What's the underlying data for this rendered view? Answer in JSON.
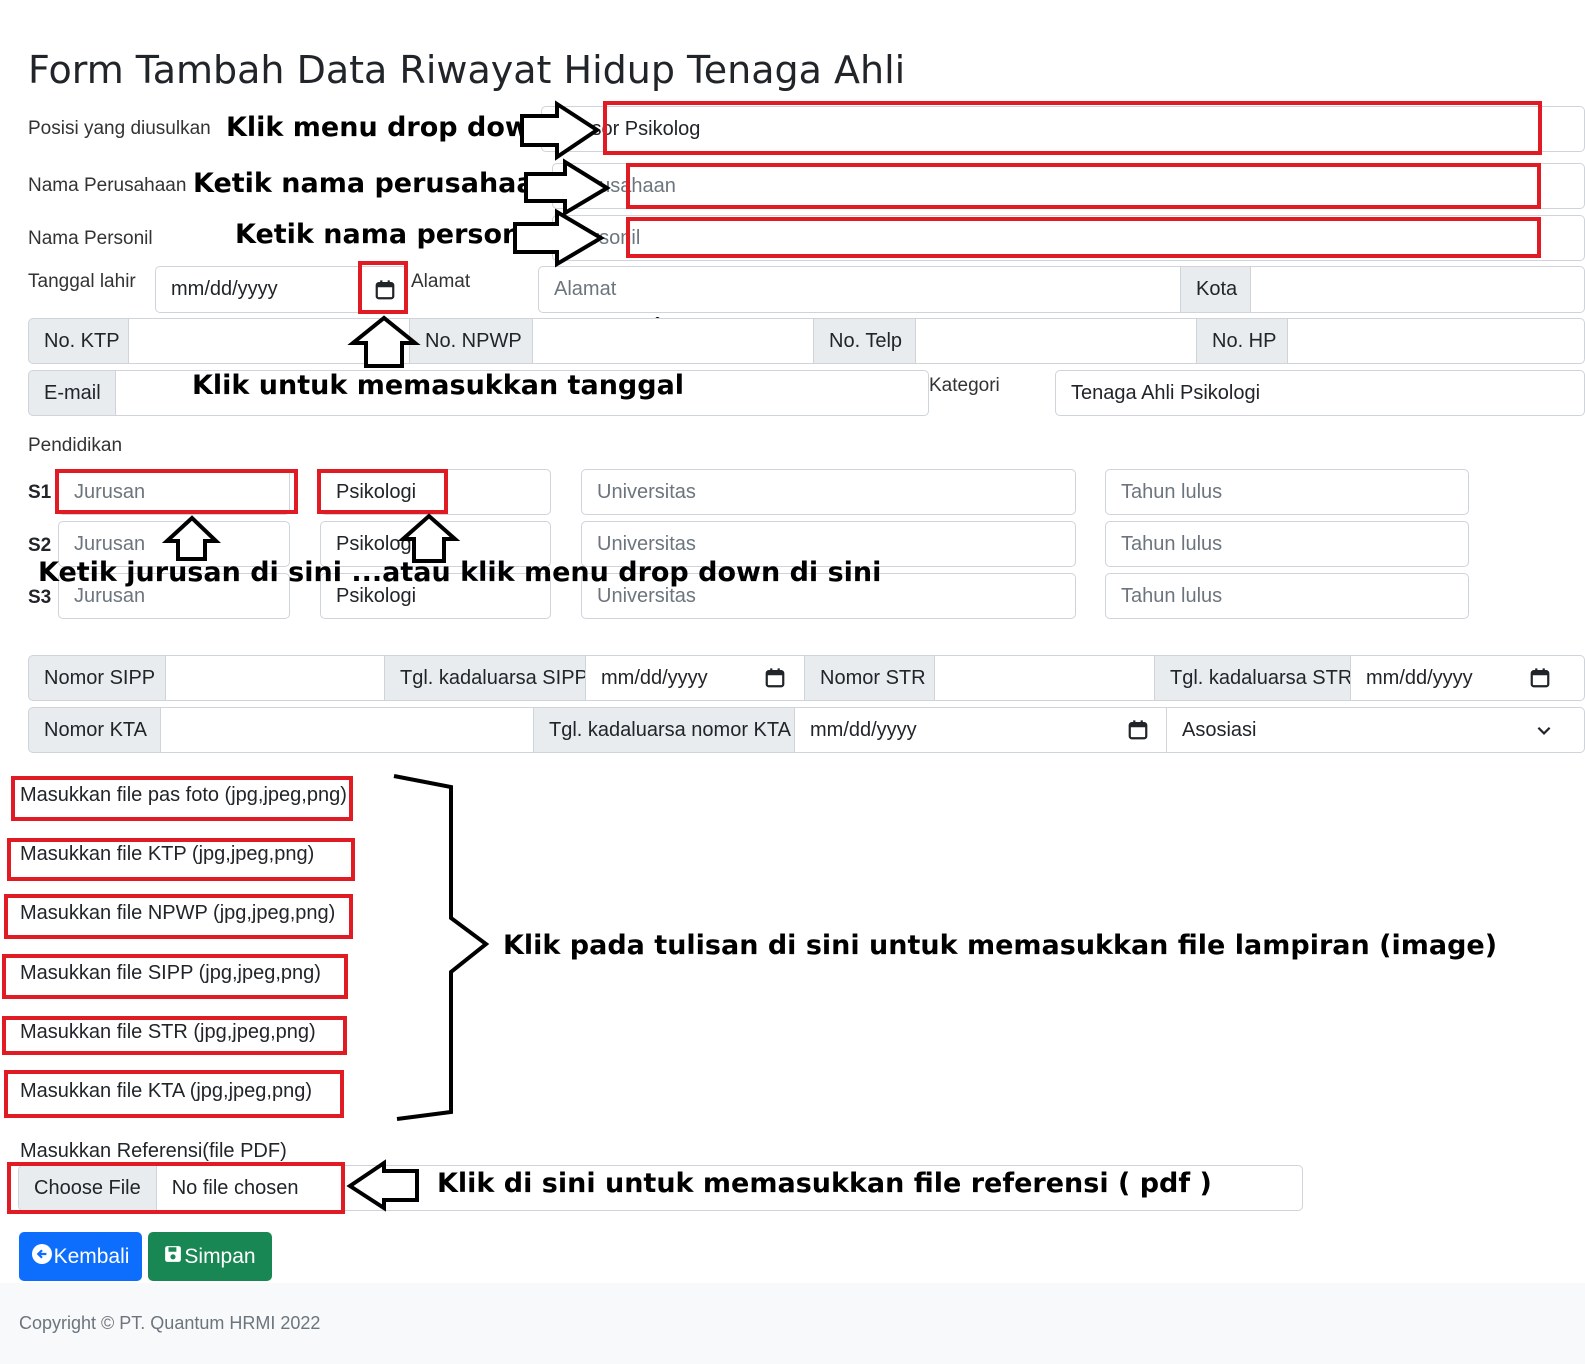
{
  "page": {
    "title": "Form Tambah Data Riwayat Hidup Tenaga Ahli"
  },
  "fields": {
    "posisi": {
      "label": "Posisi yang diusulkan",
      "value": "Asesor Psikolog"
    },
    "perusahaan": {
      "label": "Nama Perusahaan",
      "placeholder": "Perusahaan"
    },
    "personil": {
      "label": "Nama Personil",
      "placeholder": "Personil"
    },
    "tanggal_lahir": {
      "label": "Tanggal lahir",
      "placeholder": "mm/dd/yyyy"
    },
    "alamat": {
      "label": "Alamat",
      "placeholder": "Alamat"
    },
    "kota": {
      "addon": "Kota"
    },
    "ktp": {
      "addon": "No. KTP"
    },
    "npwp": {
      "addon": "No. NPWP"
    },
    "telp": {
      "addon": "No. Telp"
    },
    "hp": {
      "addon": "No. HP"
    },
    "email": {
      "addon": "E-mail"
    },
    "kategori": {
      "label": "Kategori",
      "value": "Tenaga Ahli Psikologi"
    }
  },
  "pendidikan": {
    "label": "Pendidikan",
    "rows": [
      {
        "level": "S1",
        "jurusan": "Jurusan",
        "bidang": "Psikologi",
        "universitas": "Universitas",
        "tahun": "Tahun lulus"
      },
      {
        "level": "S2",
        "jurusan": "Jurusan",
        "bidang": "Psikologi",
        "universitas": "Universitas",
        "tahun": "Tahun lulus"
      },
      {
        "level": "S3",
        "jurusan": "Jurusan",
        "bidang": "Psikologi",
        "universitas": "Universitas",
        "tahun": "Tahun lulus"
      }
    ]
  },
  "izin": {
    "sipp": "Nomor SIPP",
    "tgl_sipp": "Tgl. kadaluarsa SIPP",
    "str": "Nomor STR",
    "tgl_str": "Tgl. kadaluarsa STR",
    "kta": "Nomor KTA",
    "tgl_kta": "Tgl. kadaluarsa nomor KTA",
    "date_placeholder": "mm/dd/yyyy",
    "asosiasi": "Asosiasi"
  },
  "files": [
    "Masukkan file pas foto (jpg,jpeg,png)",
    "Masukkan file KTP (jpg,jpeg,png)",
    "Masukkan file NPWP (jpg,jpeg,png)",
    "Masukkan file SIPP (jpg,jpeg,png)",
    "Masukkan file STR (jpg,jpeg,png)",
    "Masukkan file KTA (jpg,jpeg,png)"
  ],
  "referensi": {
    "label": "Masukkan Referensi(file PDF)",
    "button": "Choose File",
    "status": "No file chosen"
  },
  "buttons": {
    "back": "Kembali",
    "save": "Simpan",
    "back_color": "#0d6efd",
    "save_color": "#198754"
  },
  "annotations": {
    "dropdown": "Klik menu drop down",
    "perusahaan": "Ketik nama perusahaan",
    "personil": "Ketik nama personil",
    "tanggal": "Klik untuk memasukkan tanggal",
    "jurusan": "Ketik jurusan di sini ...atau klik menu drop down di sini",
    "lampiran": "Klik pada tulisan di sini untuk memasukkan file lampiran (image)",
    "referensi": "Klik di sini untuk memasukkan file referensi ( pdf )",
    "highlight_color": "#e01b24"
  },
  "footer": {
    "copyright": "Copyright © PT. Quantum HRMI 2022"
  }
}
